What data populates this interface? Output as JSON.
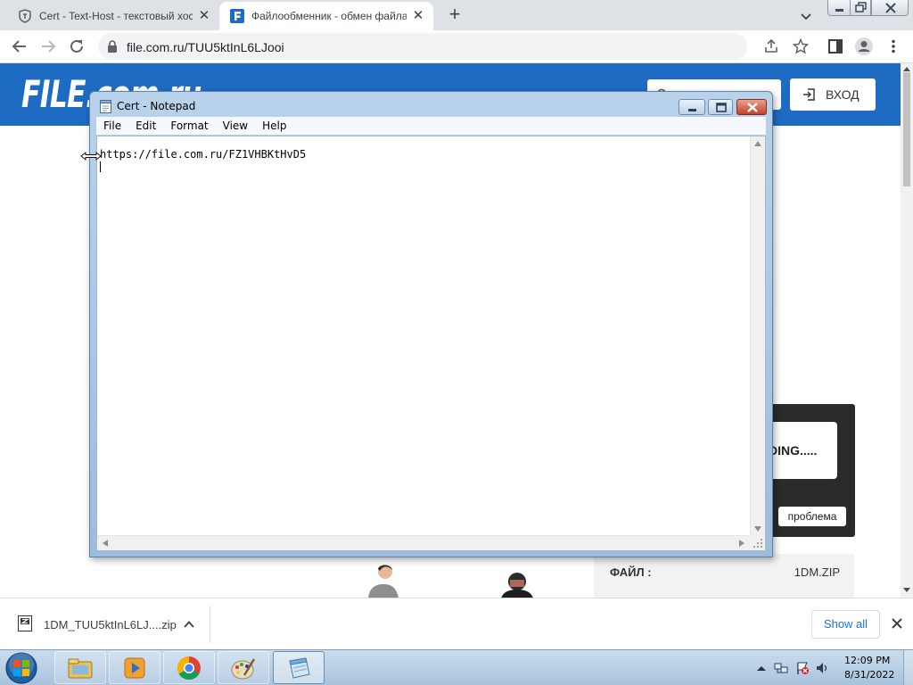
{
  "browser": {
    "tabs": [
      {
        "title": "Cert - Text-Host - текстовый хос",
        "active": false,
        "favicon": "shield-favicon-icon"
      },
      {
        "title": "Файлообменник - обмен файла",
        "active": true,
        "favicon": "file-f-favicon-icon"
      }
    ],
    "url": "file.com.ru/TUU5ktInL6LJooi",
    "colors": {
      "tabstrip": "#dee1e6",
      "omnibox": "#f1f3f4"
    }
  },
  "site": {
    "logo": "FILE.com.ru",
    "login_label": "ВХОД",
    "loading_text": "DING.....",
    "problem_label": "проблема",
    "file_label": "ФАЙЛ :",
    "file_name": "1DM.ZIP",
    "colors": {
      "header": "#1e6bc3",
      "panel": "#2b2b2b"
    }
  },
  "notepad": {
    "title": "Cert - Notepad",
    "menu": [
      "File",
      "Edit",
      "Format",
      "View",
      "Help"
    ],
    "content": "https://file.com.ru/FZ1VHBKtHvD5"
  },
  "downloads": {
    "file_name": "1DM_TUU5ktInL6LJ....zip",
    "show_all_label": "Show all"
  },
  "taskbar": {
    "apps": [
      "windows-explorer-icon",
      "media-player-icon",
      "chrome-icon",
      "paint-icon",
      "notepad-icon"
    ],
    "active_app": "notepad-icon",
    "time": "12:09 PM",
    "date": "8/31/2022"
  }
}
